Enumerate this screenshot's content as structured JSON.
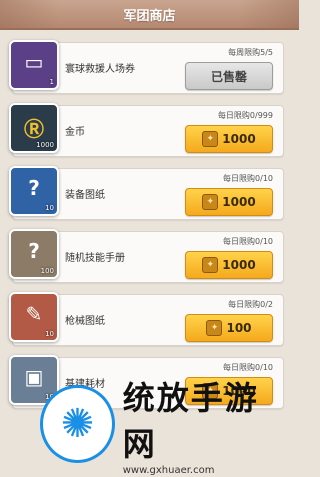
{
  "header": {
    "title": "军团商店"
  },
  "items": [
    {
      "name": "寰球救援人场券",
      "limit": "每周限购5/5",
      "button": "已售罄",
      "sold": true,
      "qty": "1",
      "icon": "ticket-icon",
      "color": "#5b3f87"
    },
    {
      "name": "金币",
      "limit": "每日限购0/999",
      "button": "1000",
      "sold": false,
      "qty": "1000",
      "icon": "gold-coin-icon",
      "color": "#2a3b4a"
    },
    {
      "name": "装备图纸",
      "limit": "每日限购0/10",
      "button": "1000",
      "sold": false,
      "qty": "10",
      "icon": "blueprint-icon",
      "color": "#2f63a6"
    },
    {
      "name": "随机技能手册",
      "limit": "每日限购0/10",
      "button": "1000",
      "sold": false,
      "qty": "100",
      "icon": "skill-book-icon",
      "color": "#8c7b66"
    },
    {
      "name": "枪械图纸",
      "limit": "每日限购0/2",
      "button": "100",
      "sold": false,
      "qty": "10",
      "icon": "gun-blueprint-icon",
      "color": "#b25a46"
    },
    {
      "name": "基建耗材",
      "limit": "每日限购0/10",
      "button": "1000",
      "sold": false,
      "qty": "10",
      "icon": "materials-icon",
      "color": "#6a7f96"
    }
  ],
  "watermark": {
    "cn": "统放手游网",
    "url": "www.gxhuaer.com"
  }
}
